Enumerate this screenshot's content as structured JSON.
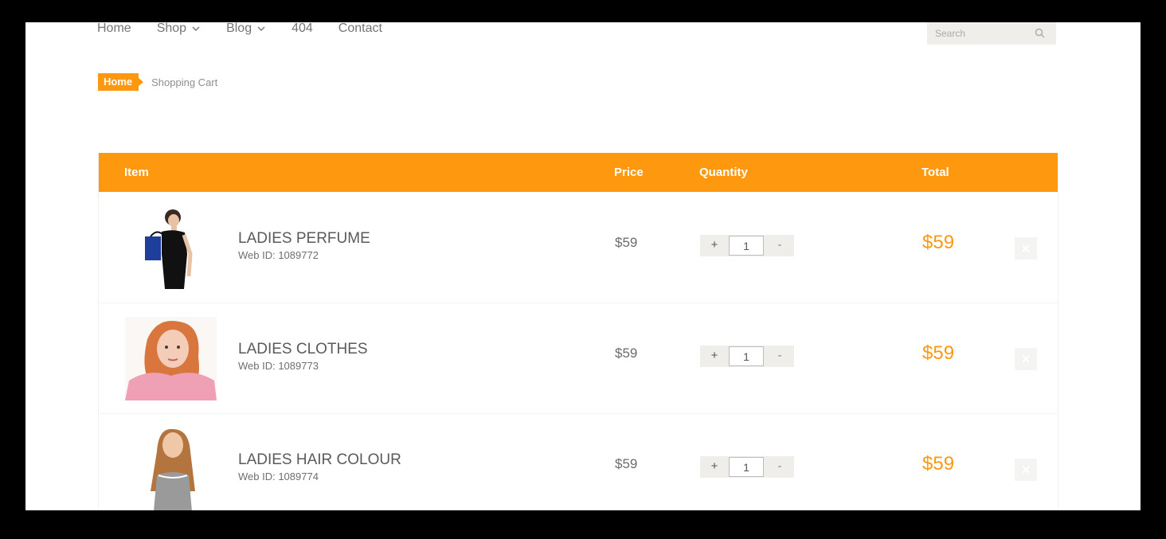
{
  "nav": {
    "items": [
      {
        "label": "Home",
        "has_dropdown": false
      },
      {
        "label": "Shop",
        "has_dropdown": true
      },
      {
        "label": "Blog",
        "has_dropdown": true
      },
      {
        "label": "404",
        "has_dropdown": false
      },
      {
        "label": "Contact",
        "has_dropdown": false
      }
    ],
    "search": {
      "placeholder": "Search",
      "icon": "search-icon"
    }
  },
  "breadcrumb": {
    "home": "Home",
    "current": "Shopping Cart"
  },
  "cart": {
    "headers": {
      "item": "Item",
      "price": "Price",
      "quantity": "Quantity",
      "total": "Total"
    },
    "rows": [
      {
        "name": "LADIES PERFUME",
        "web_id": "Web ID: 1089772",
        "price": "$59",
        "quantity": "1",
        "total": "$59",
        "plus": "+",
        "minus": "-"
      },
      {
        "name": "LADIES CLOTHES",
        "web_id": "Web ID: 1089773",
        "price": "$59",
        "quantity": "1",
        "total": "$59",
        "plus": "+",
        "minus": "-"
      },
      {
        "name": "LADIES HAIR COLOUR",
        "web_id": "Web ID: 1089774",
        "price": "$59",
        "quantity": "1",
        "total": "$59",
        "plus": "+",
        "minus": "-"
      }
    ]
  },
  "colors": {
    "accent": "#fe980f",
    "header_text": "#ffffff",
    "search_bg": "#efeeeb"
  }
}
